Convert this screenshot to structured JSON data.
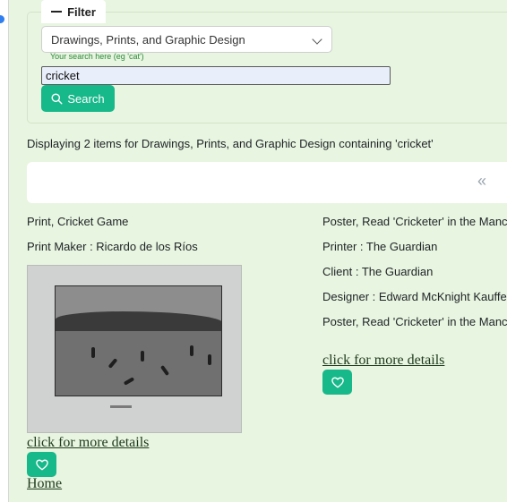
{
  "filter": {
    "tab_label": "Filter",
    "category_selected": "Drawings, Prints, and Graphic Design",
    "search_hint": "Your search here (eg 'cat')",
    "search_value": "cricket",
    "search_button_label": "Search"
  },
  "results": {
    "status_text": "Displaying 2 items for Drawings, Prints, and Graphic Design containing 'cricket'",
    "pager_prev_label": "«"
  },
  "items": [
    {
      "title": "Print, Cricket Game",
      "maker": "Print Maker : Ricardo de los Ríos",
      "details_link": "click for more details"
    },
    {
      "title": "Poster, Read 'Cricketer' in the Manc",
      "printer": "Printer : The Guardian",
      "client": "Client : The Guardian",
      "designer": "Designer : Edward McKnight Kauffe",
      "title_repeat": "Poster, Read 'Cricketer' in the Manc",
      "details_link": "click for more details"
    }
  ],
  "footer": {
    "home_link": "Home"
  },
  "colors": {
    "accent": "#17b88a",
    "page_bg": "#e8f5e0"
  }
}
